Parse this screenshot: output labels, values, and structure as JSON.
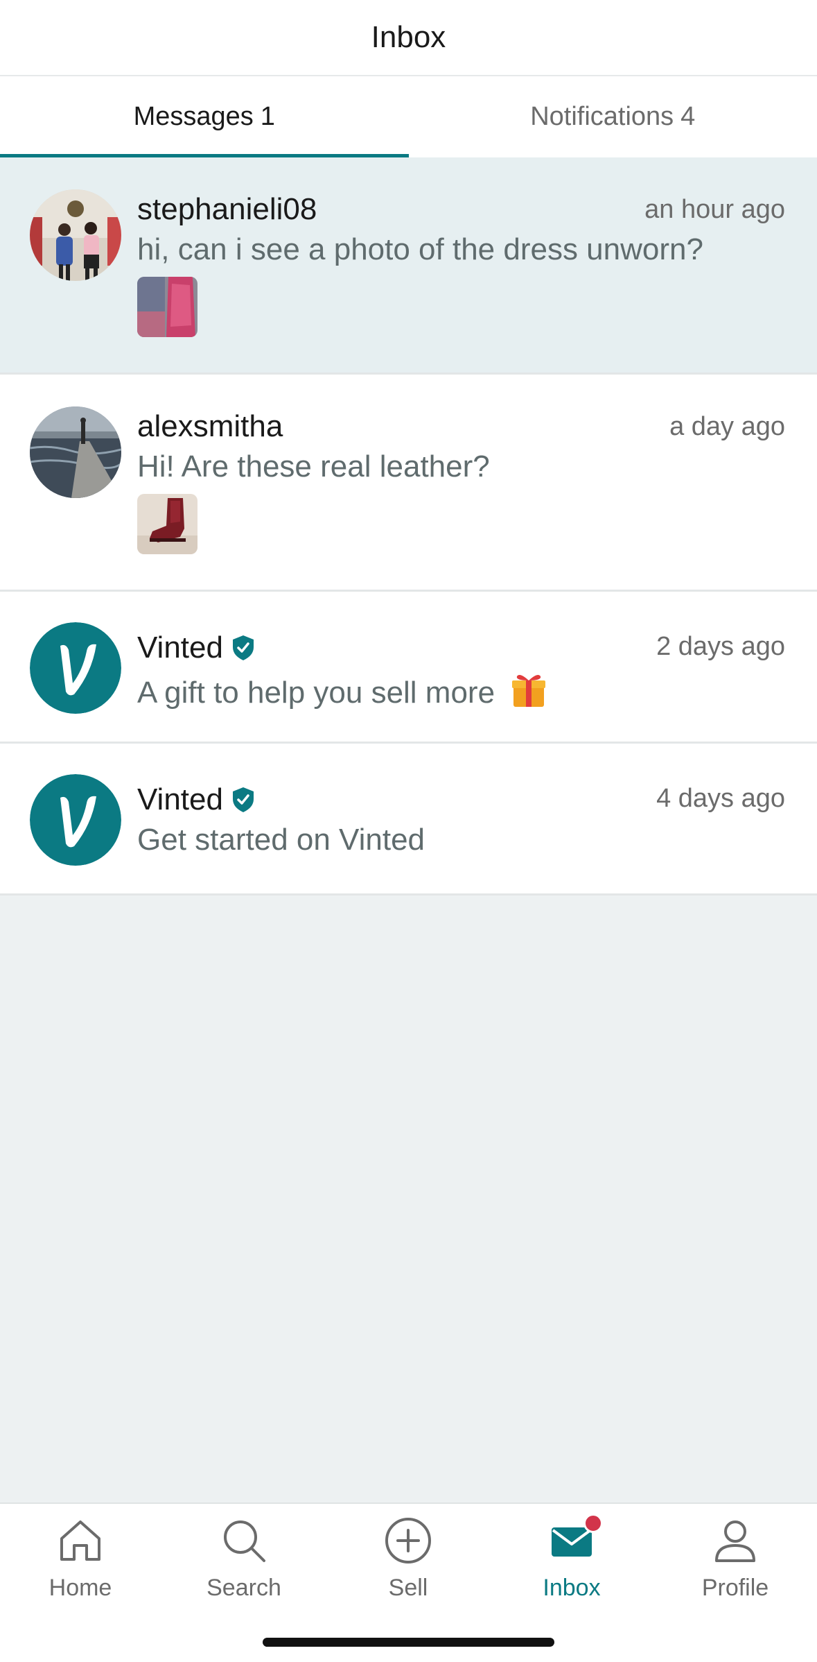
{
  "header": {
    "title": "Inbox"
  },
  "tabs": [
    {
      "label": "Messages",
      "count": "1"
    },
    {
      "label": "Notifications",
      "count": "4"
    }
  ],
  "conversations": [
    {
      "username": "stephanieli08",
      "time": "an hour ago",
      "preview": "hi, can i see a photo of the dress unworn?",
      "avatar_icon": "user-photo",
      "thumb_icon": "pink-dress-photo"
    },
    {
      "username": "alexsmitha",
      "time": "a day ago",
      "preview": "Hi! Are these real leather?",
      "avatar_icon": "user-photo",
      "thumb_icon": "red-boot-photo"
    },
    {
      "username": "Vinted",
      "time": "2 days ago",
      "preview": "A gift to help you sell more",
      "avatar_icon": "vinted-logo",
      "emoji": "gift-emoji"
    },
    {
      "username": "Vinted",
      "time": "4 days ago",
      "preview": "Get started on Vinted",
      "avatar_icon": "vinted-logo"
    }
  ],
  "nav": [
    {
      "label": "Home",
      "icon": "home-icon"
    },
    {
      "label": "Search",
      "icon": "search-icon"
    },
    {
      "label": "Sell",
      "icon": "plus-circle-icon"
    },
    {
      "label": "Inbox",
      "icon": "mail-icon"
    },
    {
      "label": "Profile",
      "icon": "person-icon"
    }
  ],
  "colors": {
    "accent": "#0b7a83",
    "badge": "#d2344a",
    "highlight_row": "#e6eff1",
    "background": "#edf1f2"
  }
}
